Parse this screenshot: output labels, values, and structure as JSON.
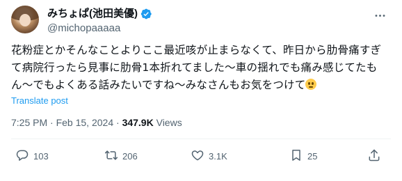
{
  "author": {
    "display_name": "みちょぱ(池田美優)",
    "handle": "@michopaaaaa"
  },
  "tweet": {
    "text": "花粉症とかそんなことよりここ最近咳が止まらなくて、昨日から肋骨痛すぎて病院行ったら見事に肋骨1本折れてました〜車の揺れでも痛み感じてたもん〜でもよくある話みたいですね〜みなさんもお気をつけて",
    "translate_label": "Translate post"
  },
  "meta": {
    "time": "7:25 PM",
    "separator": "·",
    "date": "Feb 15, 2024",
    "views_count": "347.9K",
    "views_label": "Views"
  },
  "actions": {
    "replies": "103",
    "reposts": "206",
    "likes": "3.1K",
    "bookmarks": "25"
  },
  "icons": {
    "verified": "verified-badge-icon",
    "more": "more-icon",
    "reply": "reply-icon",
    "retweet": "retweet-icon",
    "like": "heart-icon",
    "bookmark": "bookmark-icon",
    "share": "share-icon",
    "emoji": "pleading-face-emoji"
  },
  "colors": {
    "accent": "#1d9bf0",
    "secondary_text": "#536471"
  }
}
